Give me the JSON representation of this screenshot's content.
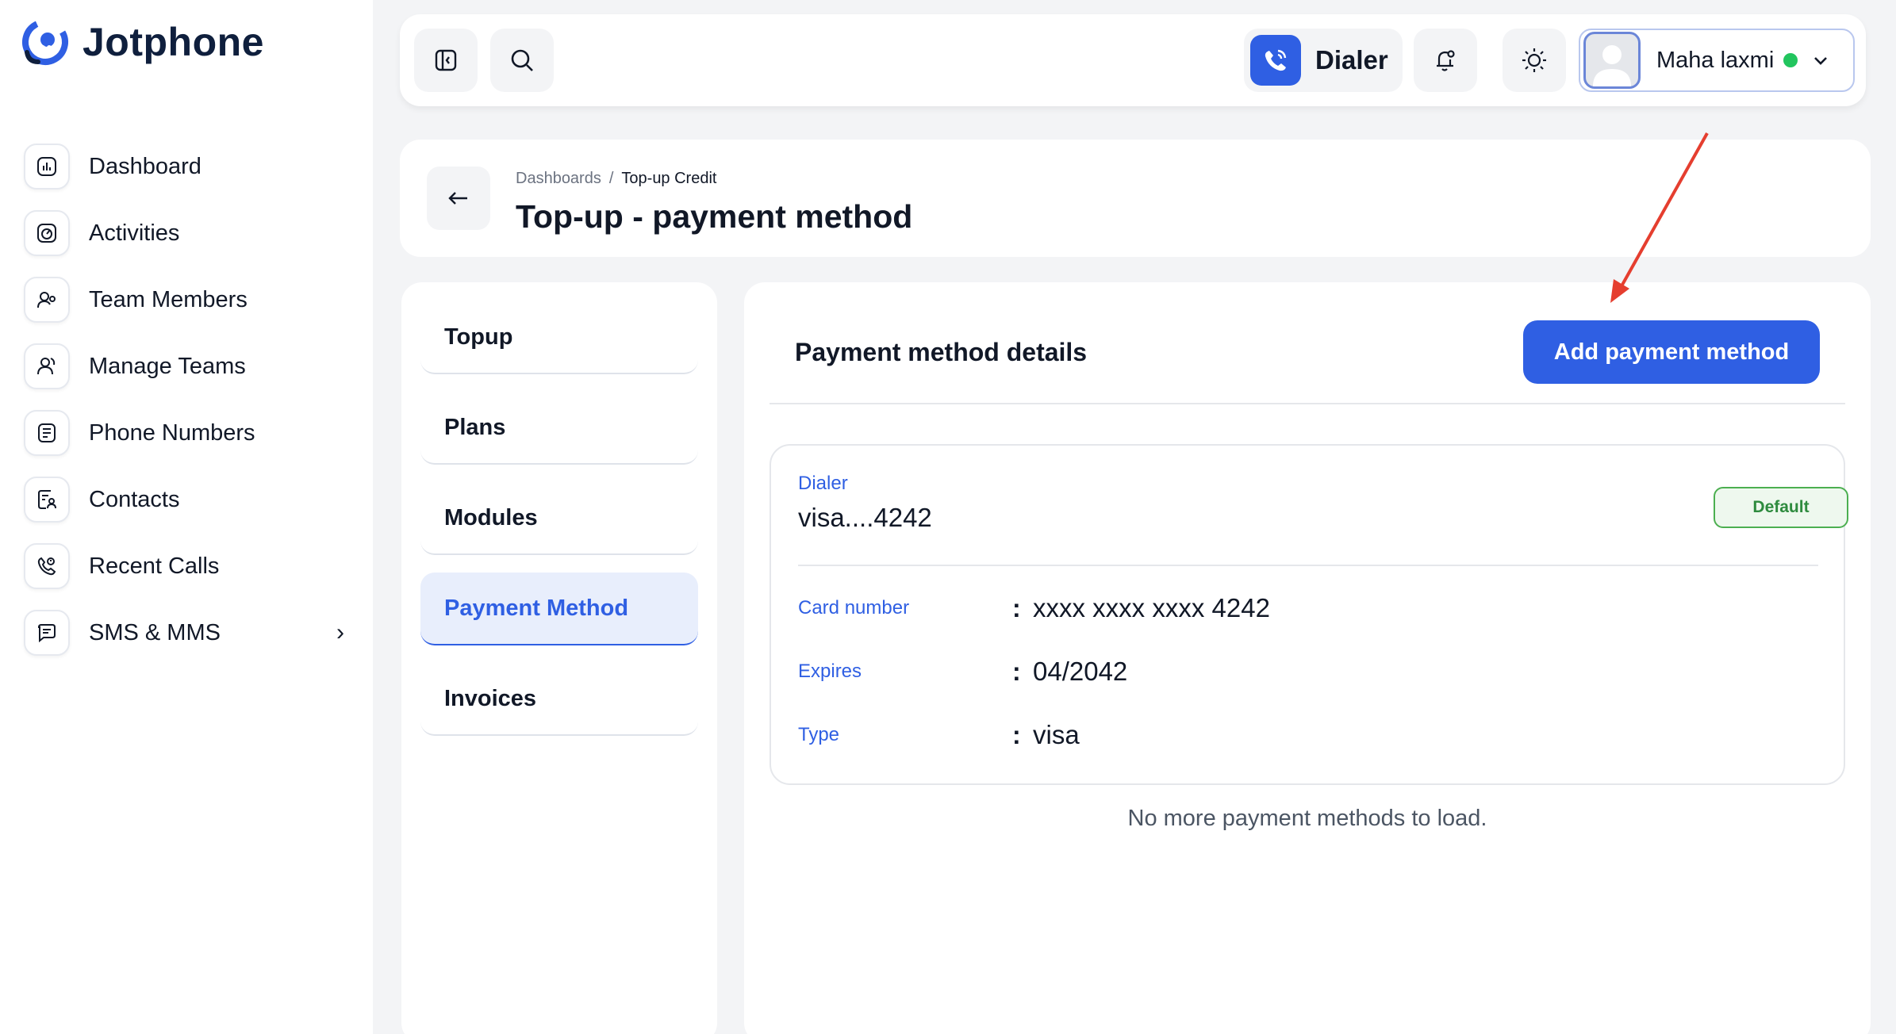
{
  "app": {
    "name": "Jotphone"
  },
  "sidebar": {
    "items": [
      {
        "label": "Dashboard",
        "icon": "dashboard-icon"
      },
      {
        "label": "Activities",
        "icon": "activities-icon"
      },
      {
        "label": "Team Members",
        "icon": "team-members-icon"
      },
      {
        "label": "Manage Teams",
        "icon": "manage-teams-icon"
      },
      {
        "label": "Phone Numbers",
        "icon": "phone-numbers-icon"
      },
      {
        "label": "Contacts",
        "icon": "contacts-icon"
      },
      {
        "label": "Recent Calls",
        "icon": "recent-calls-icon"
      },
      {
        "label": "SMS & MMS",
        "icon": "sms-icon"
      }
    ]
  },
  "topbar": {
    "dialer_label": "Dialer",
    "user_name": "Maha laxmi"
  },
  "header": {
    "breadcrumb": [
      "Dashboards",
      "Top-up Credit"
    ],
    "title": "Top-up - payment method"
  },
  "submenu": {
    "items": [
      "Topup",
      "Plans",
      "Modules",
      "Payment Method",
      "Invoices"
    ],
    "active": "Payment Method"
  },
  "panel": {
    "title": "Payment method details",
    "add_button": "Add payment method",
    "card": {
      "brand_label": "Dialer",
      "masked": "visa....4242",
      "badge": "Default",
      "rows": [
        {
          "label": "Card number",
          "value": "xxxx xxxx xxxx 4242"
        },
        {
          "label": "Expires",
          "value": "04/2042"
        },
        {
          "label": "Type",
          "value": "visa"
        }
      ],
      "separator": ":"
    },
    "footer_text": "No more payment methods to load."
  },
  "colors": {
    "accent": "#2f5fe3",
    "active_bg": "#e8eefc",
    "default_badge": "#4caf50",
    "online": "#22c55e",
    "annotation_arrow": "#e53e2f"
  }
}
